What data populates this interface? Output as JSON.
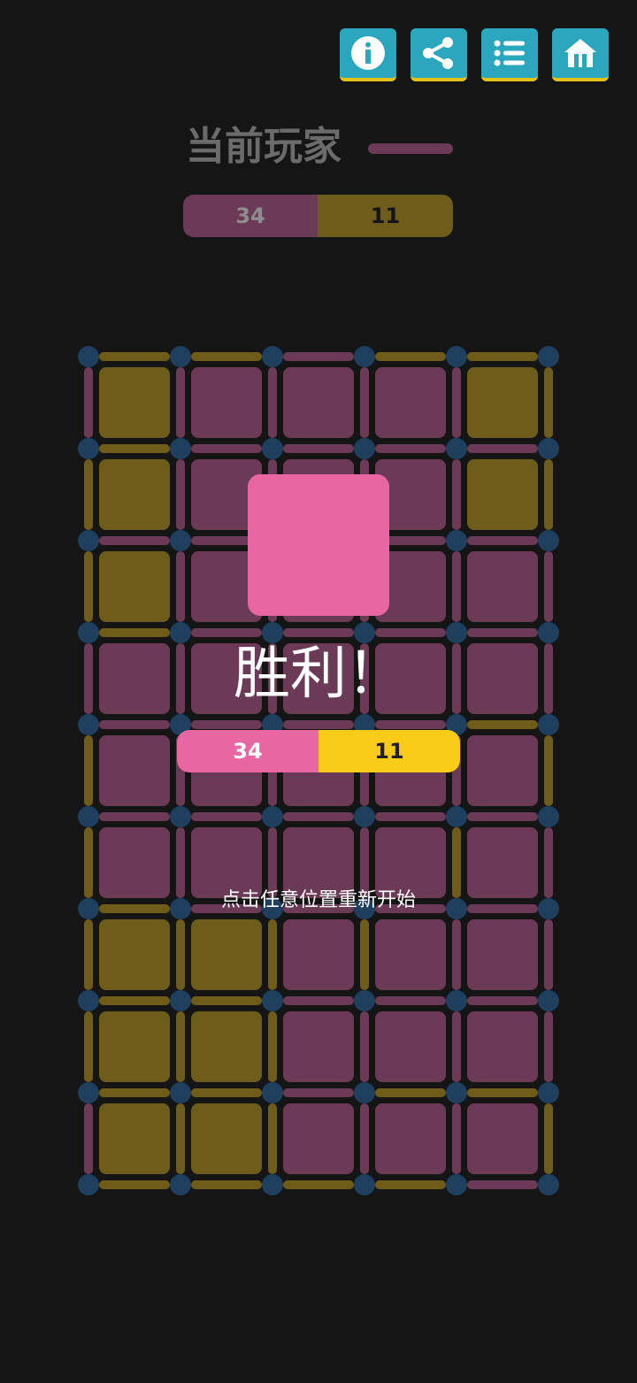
{
  "toolbar": {
    "buttons": [
      {
        "name": "info-button",
        "icon": "info-icon"
      },
      {
        "name": "share-button",
        "icon": "share-icon"
      },
      {
        "name": "list-button",
        "icon": "list-icon"
      },
      {
        "name": "home-button",
        "icon": "home-icon"
      }
    ]
  },
  "status": {
    "current_player_label": "当前玩家",
    "score_p1": "34",
    "score_p2": "11"
  },
  "colors": {
    "p1_owned": "#6b3a56",
    "p2_owned": "#6d5c1a",
    "p1_bright": "#e866a2",
    "p2_bright": "#facc17",
    "dot": "#1f3f5f",
    "background": "#151515",
    "toolbar": "#2ba7bd"
  },
  "board": {
    "cols": 5,
    "rows": 9,
    "cells": [
      [
        "B",
        "A",
        "A",
        "A",
        "B"
      ],
      [
        "B",
        "A",
        "A",
        "A",
        "B"
      ],
      [
        "B",
        "A",
        "A",
        "A",
        "A"
      ],
      [
        "A",
        "A",
        "A",
        "A",
        "A"
      ],
      [
        "A",
        "A",
        "A",
        "A",
        "A"
      ],
      [
        "A",
        "A",
        "A",
        "A",
        "A"
      ],
      [
        "B",
        "B",
        "A",
        "A",
        "A"
      ],
      [
        "B",
        "B",
        "A",
        "A",
        "A"
      ],
      [
        "B",
        "B",
        "A",
        "A",
        "A"
      ]
    ],
    "h_edges": [
      [
        "B",
        "B",
        "A",
        "B",
        "B"
      ],
      [
        "B",
        "A",
        "A",
        "A",
        "A"
      ],
      [
        "A",
        "A",
        "A",
        "A",
        "A"
      ],
      [
        "B",
        "A",
        "A",
        "A",
        "A"
      ],
      [
        "A",
        "A",
        "A",
        "A",
        "B"
      ],
      [
        "A",
        "A",
        "A",
        "A",
        "A"
      ],
      [
        "B",
        "A",
        "A",
        "A",
        "A"
      ],
      [
        "B",
        "B",
        "A",
        "A",
        "A"
      ],
      [
        "B",
        "B",
        "A",
        "B",
        "B"
      ],
      [
        "B",
        "B",
        "B",
        "B",
        "A"
      ]
    ],
    "v_edges": [
      [
        "A",
        "A",
        "A",
        "A",
        "A",
        "B"
      ],
      [
        "B",
        "A",
        "A",
        "A",
        "A",
        "B"
      ],
      [
        "B",
        "A",
        "A",
        "A",
        "A",
        "A"
      ],
      [
        "A",
        "A",
        "A",
        "A",
        "A",
        "A"
      ],
      [
        "B",
        "A",
        "A",
        "A",
        "A",
        "B"
      ],
      [
        "B",
        "A",
        "A",
        "A",
        "B",
        "A"
      ],
      [
        "B",
        "B",
        "B",
        "B",
        "A",
        "A"
      ],
      [
        "B",
        "B",
        "B",
        "A",
        "A",
        "A"
      ],
      [
        "A",
        "B",
        "B",
        "A",
        "A",
        "B"
      ]
    ]
  },
  "result": {
    "title": "胜利！",
    "score_p1": "34",
    "score_p2": "11",
    "restart_hint": "点击任意位置重新开始"
  }
}
